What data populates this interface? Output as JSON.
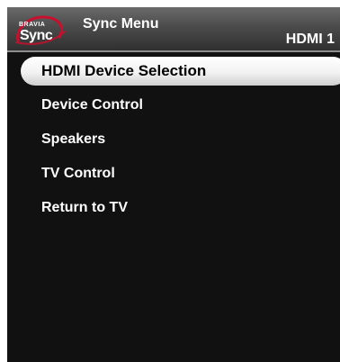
{
  "header": {
    "logo_brand": "BRAVIA",
    "logo_word": "Sync",
    "title": "Sync Menu",
    "input_label": "HDMI 1"
  },
  "menu": {
    "items": [
      {
        "label": "HDMI Device Selection",
        "selected": true
      },
      {
        "label": "Device Control",
        "selected": false
      },
      {
        "label": "Speakers",
        "selected": false
      },
      {
        "label": "TV Control",
        "selected": false
      },
      {
        "label": "Return to TV",
        "selected": false
      }
    ]
  },
  "colors": {
    "background": "#111111",
    "header": "#4b4b4b",
    "highlight": "#ffffff",
    "logo_accent": "#c8102e"
  },
  "icons": {
    "logo": "bravia-sync-logo"
  }
}
